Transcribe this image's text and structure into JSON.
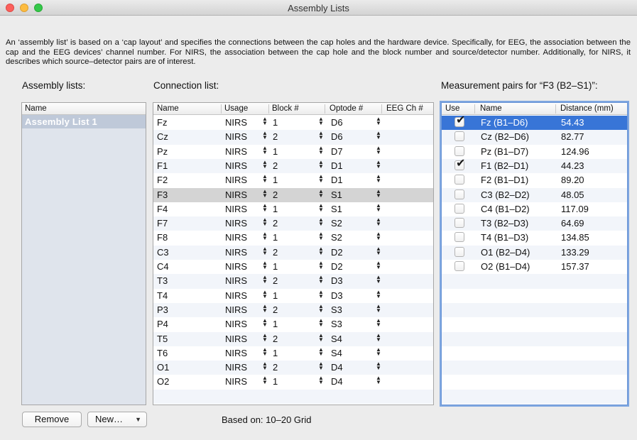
{
  "window": {
    "title": "Assembly Lists"
  },
  "description": "An ‘assembly list’ is based on a ‘cap layout’ and specifies the connections between the cap holes and the hardware device. Specifically, for EEG, the association between the cap and the EEG devices’ channel number. For NIRS, the association between the cap hole and the block number and source/detector number. Additionally, for NIRS, it describes which source–detector pairs are of interest.",
  "assembly_lists": {
    "label": "Assembly lists:",
    "header": "Name",
    "items": [
      "Assembly List 1"
    ],
    "selected_index": 0
  },
  "connection_list": {
    "label": "Connection list:",
    "columns": [
      "Name",
      "Usage",
      "Block #",
      "Optode #",
      "EEG Ch #"
    ],
    "selected_index": 5,
    "rows": [
      {
        "name": "Fz",
        "usage": "NIRS",
        "block": "1",
        "optode": "D6",
        "eeg": ""
      },
      {
        "name": "Cz",
        "usage": "NIRS",
        "block": "2",
        "optode": "D6",
        "eeg": ""
      },
      {
        "name": "Pz",
        "usage": "NIRS",
        "block": "1",
        "optode": "D7",
        "eeg": ""
      },
      {
        "name": "F1",
        "usage": "NIRS",
        "block": "2",
        "optode": "D1",
        "eeg": ""
      },
      {
        "name": "F2",
        "usage": "NIRS",
        "block": "1",
        "optode": "D1",
        "eeg": ""
      },
      {
        "name": "F3",
        "usage": "NIRS",
        "block": "2",
        "optode": "S1",
        "eeg": ""
      },
      {
        "name": "F4",
        "usage": "NIRS",
        "block": "1",
        "optode": "S1",
        "eeg": ""
      },
      {
        "name": "F7",
        "usage": "NIRS",
        "block": "2",
        "optode": "S2",
        "eeg": ""
      },
      {
        "name": "F8",
        "usage": "NIRS",
        "block": "1",
        "optode": "S2",
        "eeg": ""
      },
      {
        "name": "C3",
        "usage": "NIRS",
        "block": "2",
        "optode": "D2",
        "eeg": ""
      },
      {
        "name": "C4",
        "usage": "NIRS",
        "block": "1",
        "optode": "D2",
        "eeg": ""
      },
      {
        "name": "T3",
        "usage": "NIRS",
        "block": "2",
        "optode": "D3",
        "eeg": ""
      },
      {
        "name": "T4",
        "usage": "NIRS",
        "block": "1",
        "optode": "D3",
        "eeg": ""
      },
      {
        "name": "P3",
        "usage": "NIRS",
        "block": "2",
        "optode": "S3",
        "eeg": ""
      },
      {
        "name": "P4",
        "usage": "NIRS",
        "block": "1",
        "optode": "S3",
        "eeg": ""
      },
      {
        "name": "T5",
        "usage": "NIRS",
        "block": "2",
        "optode": "S4",
        "eeg": ""
      },
      {
        "name": "T6",
        "usage": "NIRS",
        "block": "1",
        "optode": "S4",
        "eeg": ""
      },
      {
        "name": "O1",
        "usage": "NIRS",
        "block": "2",
        "optode": "D4",
        "eeg": ""
      },
      {
        "name": "O2",
        "usage": "NIRS",
        "block": "1",
        "optode": "D4",
        "eeg": ""
      }
    ]
  },
  "measurement_pairs": {
    "label": "Measurement pairs for “F3 (B2–S1)”:",
    "columns": [
      "Use",
      "Name",
      "Distance (mm)"
    ],
    "selected_index": 0,
    "rows": [
      {
        "use": true,
        "name": "Fz (B1–D6)",
        "distance": "54.43"
      },
      {
        "use": false,
        "name": "Cz (B2–D6)",
        "distance": "82.77"
      },
      {
        "use": false,
        "name": "Pz (B1–D7)",
        "distance": "124.96"
      },
      {
        "use": true,
        "name": "F1 (B2–D1)",
        "distance": "44.23"
      },
      {
        "use": false,
        "name": "F2 (B1–D1)",
        "distance": "89.20"
      },
      {
        "use": false,
        "name": "C3 (B2–D2)",
        "distance": "48.05"
      },
      {
        "use": false,
        "name": "C4 (B1–D2)",
        "distance": "117.09"
      },
      {
        "use": false,
        "name": "T3 (B2–D3)",
        "distance": "64.69"
      },
      {
        "use": false,
        "name": "T4 (B1–D3)",
        "distance": "134.85"
      },
      {
        "use": false,
        "name": "O1 (B2–D4)",
        "distance": "133.29"
      },
      {
        "use": false,
        "name": "O2 (B1–D4)",
        "distance": "157.37"
      }
    ]
  },
  "buttons": {
    "remove": "Remove",
    "new": "New…"
  },
  "based_on": "Based on:  10–20 Grid",
  "icons": {
    "stepper": "updown-arrows-icon",
    "checkbox": "checkmark-icon",
    "popup": "chevron-down-icon"
  },
  "colors": {
    "selection_blue": "#3875d7",
    "selection_grey": "#d4d4d4",
    "sidebar_bg": "#dfe4ec",
    "sidebar_selected": "#bfc9d9"
  }
}
